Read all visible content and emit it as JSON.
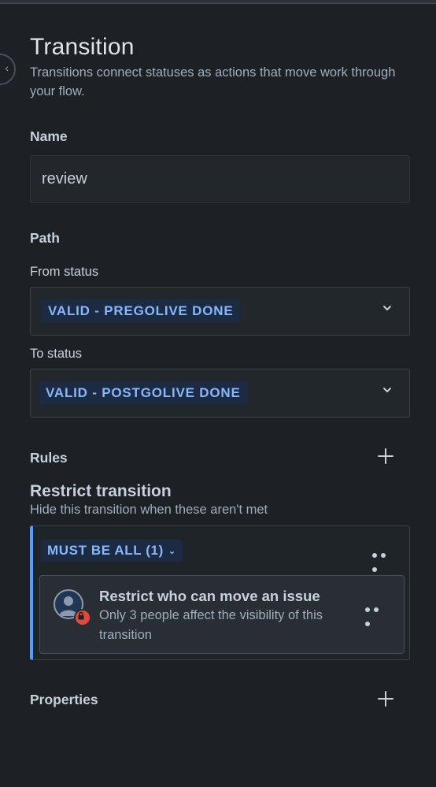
{
  "panel": {
    "title": "Transition",
    "description": "Transitions connect statuses as actions that move work through your flow."
  },
  "name_section": {
    "label": "Name",
    "value": "review"
  },
  "path": {
    "label": "Path",
    "from_label": "From status",
    "from_value": "VALID - PREGOLIVE DONE",
    "to_label": "To status",
    "to_value": "VALID - POSTGOLIVE DONE"
  },
  "rules": {
    "label": "Rules",
    "restrict_title": "Restrict transition",
    "restrict_description": "Hide this transition when these aren't met",
    "condition_group": "MUST BE ALL (1)",
    "rule_card": {
      "title": "Restrict who can move an issue",
      "description": "Only 3 people affect the visibility of this transition",
      "icon": "user-lock-icon"
    }
  },
  "properties": {
    "label": "Properties"
  },
  "colors": {
    "background": "#1d2125",
    "lozenge_bg": "#1c2b41",
    "lozenge_text": "#85b8ff",
    "accent_border": "#579dff",
    "lock_badge": "#e2483d"
  }
}
